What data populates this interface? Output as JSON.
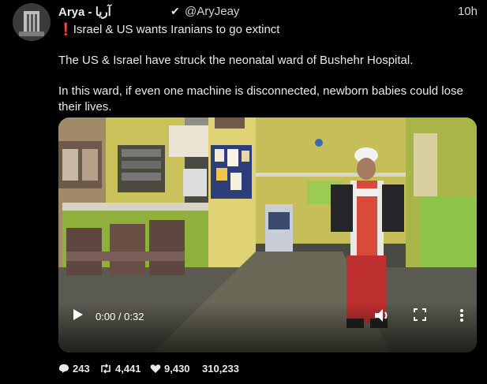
{
  "author": {
    "display_name": "Arya - آریا",
    "handle": "@AryJeay",
    "time": "10h",
    "verified": true
  },
  "tweet": {
    "headline": "Israel & US wants Iranians to go extinct",
    "headline_prefix": "❗",
    "paragraph_1": "The US & Israel have struck the neonatal ward of Bushehr Hospital.",
    "paragraph_2": "In this ward, if even one machine is disconnected, newborn babies could lose their lives."
  },
  "video": {
    "time_readout": "0:00 / 0:32",
    "play_icon": "play-icon",
    "volume_icon": "volume-icon",
    "fullscreen_icon": "fullscreen-icon",
    "more_icon": "more-vertical-icon"
  },
  "stats": {
    "replies": "243",
    "reposts": "4,441",
    "likes": "9,430",
    "views": "310,233"
  },
  "colors": {
    "background": "#000000",
    "text": "#e7e9ea",
    "alert_red": "#f4212e",
    "wall_yellow": "#c9c25a",
    "counter_green": "#8fb03a"
  }
}
